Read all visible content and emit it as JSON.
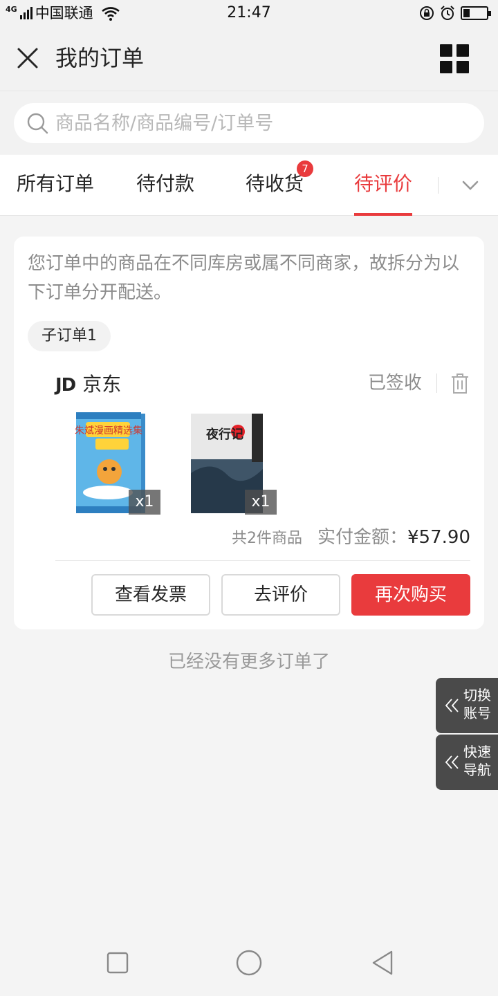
{
  "status_bar": {
    "network": "4G",
    "carrier": "中国联通",
    "time": "21:47"
  },
  "header": {
    "title": "我的订单"
  },
  "search": {
    "placeholder": "商品名称/商品编号/订单号"
  },
  "tabs": [
    {
      "label": "所有订单",
      "active": false
    },
    {
      "label": "待付款",
      "active": false
    },
    {
      "label": "待收货",
      "active": false,
      "badge": "7"
    },
    {
      "label": "待评价",
      "active": true
    }
  ],
  "order": {
    "notice": "您订单中的商品在不同库房或属不同商家，故拆分为以下订单分开配送。",
    "sub_order_label": "子订单1",
    "shop_logo": "JD",
    "shop_name": "京东",
    "status": "已签收",
    "products": [
      {
        "qty": "x1",
        "cover_text": "朱斌漫画精选集"
      },
      {
        "qty": "x1",
        "cover_text": "夜行记"
      }
    ],
    "item_count": "共2件商品",
    "paid_label": "实付金额：",
    "paid_amount": "¥57.90",
    "buttons": {
      "invoice": "查看发票",
      "review": "去评价",
      "rebuy": "再次购买"
    }
  },
  "no_more": "已经没有更多订单了",
  "side_tools": [
    {
      "label": "切换账号"
    },
    {
      "label": "快速导航"
    }
  ],
  "colors": {
    "accent": "#e93b3d",
    "background": "#f4f4f4",
    "muted_text": "#8c8c8c"
  }
}
